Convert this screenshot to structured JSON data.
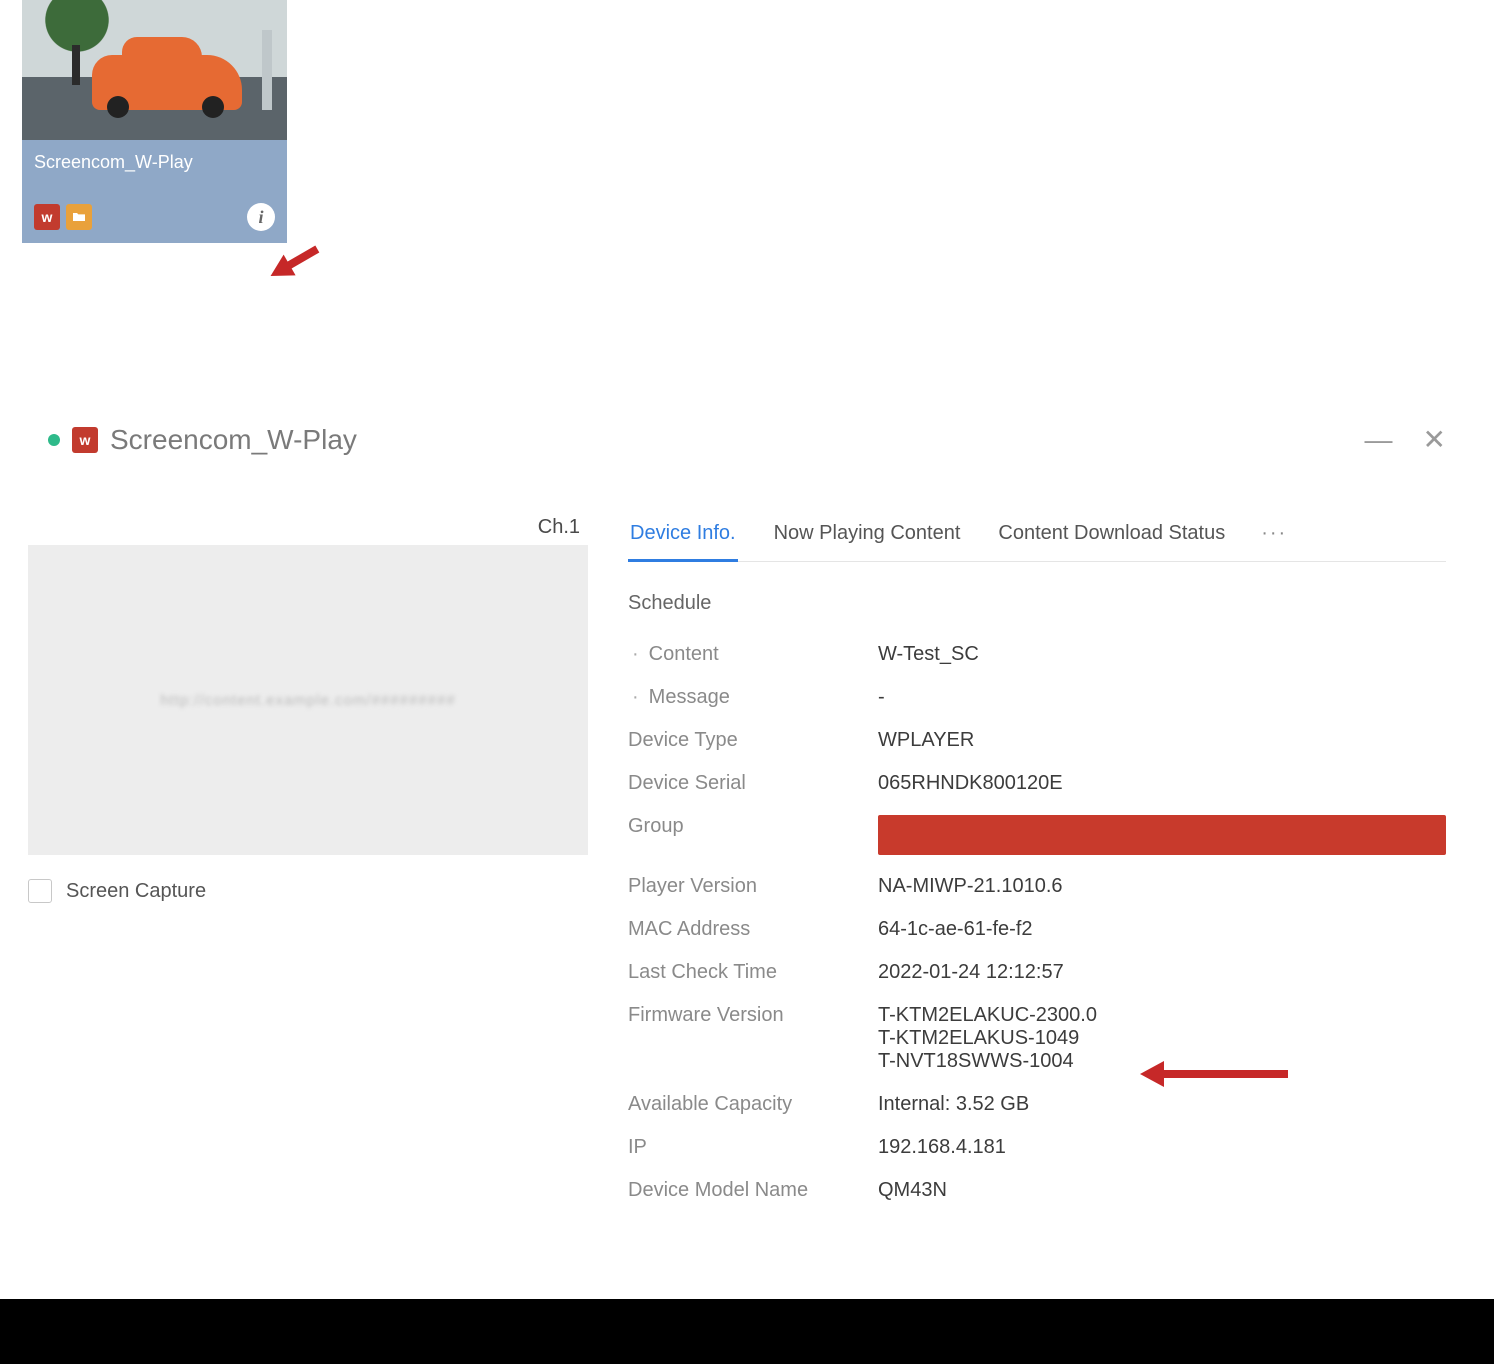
{
  "thumbnail": {
    "title": "Screencom_W-Play",
    "badge_w": "w",
    "info_icon_glyph": "i"
  },
  "panel": {
    "title": "Screencom_W-Play",
    "title_badge": "w",
    "minimize_glyph": "—",
    "close_glyph": "✕",
    "channel_label": "Ch.1",
    "preview_placeholder": "http://content.example.com/#########",
    "screen_capture_label": "Screen Capture",
    "tabs": {
      "device_info": "Device Info.",
      "now_playing": "Now Playing Content",
      "download_status": "Content Download Status",
      "more_glyph": "···"
    },
    "schedule_section": "Schedule",
    "rows": {
      "content_label": "Content",
      "content_value": "W-Test_SC",
      "message_label": "Message",
      "message_value": "-",
      "device_type_label": "Device Type",
      "device_type_value": "WPLAYER",
      "device_serial_label": "Device Serial",
      "device_serial_value": "065RHNDK800120E",
      "group_label": "Group",
      "player_version_label": "Player Version",
      "player_version_value": "NA-MIWP-21.1010.6",
      "mac_label": "MAC Address",
      "mac_value": "64-1c-ae-61-fe-f2",
      "last_check_label": "Last Check Time",
      "last_check_value": "2022-01-24 12:12:57",
      "firmware_label": "Firmware Version",
      "firmware_v1": "T-KTM2ELAKUC-2300.0",
      "firmware_v2": "T-KTM2ELAKUS-1049",
      "firmware_v3": "T-NVT18SWWS-1004",
      "capacity_label": "Available Capacity",
      "capacity_value": "Internal: 3.52 GB",
      "ip_label": "IP",
      "ip_value": "192.168.4.181",
      "model_label": "Device Model Name",
      "model_value": "QM43N"
    }
  }
}
